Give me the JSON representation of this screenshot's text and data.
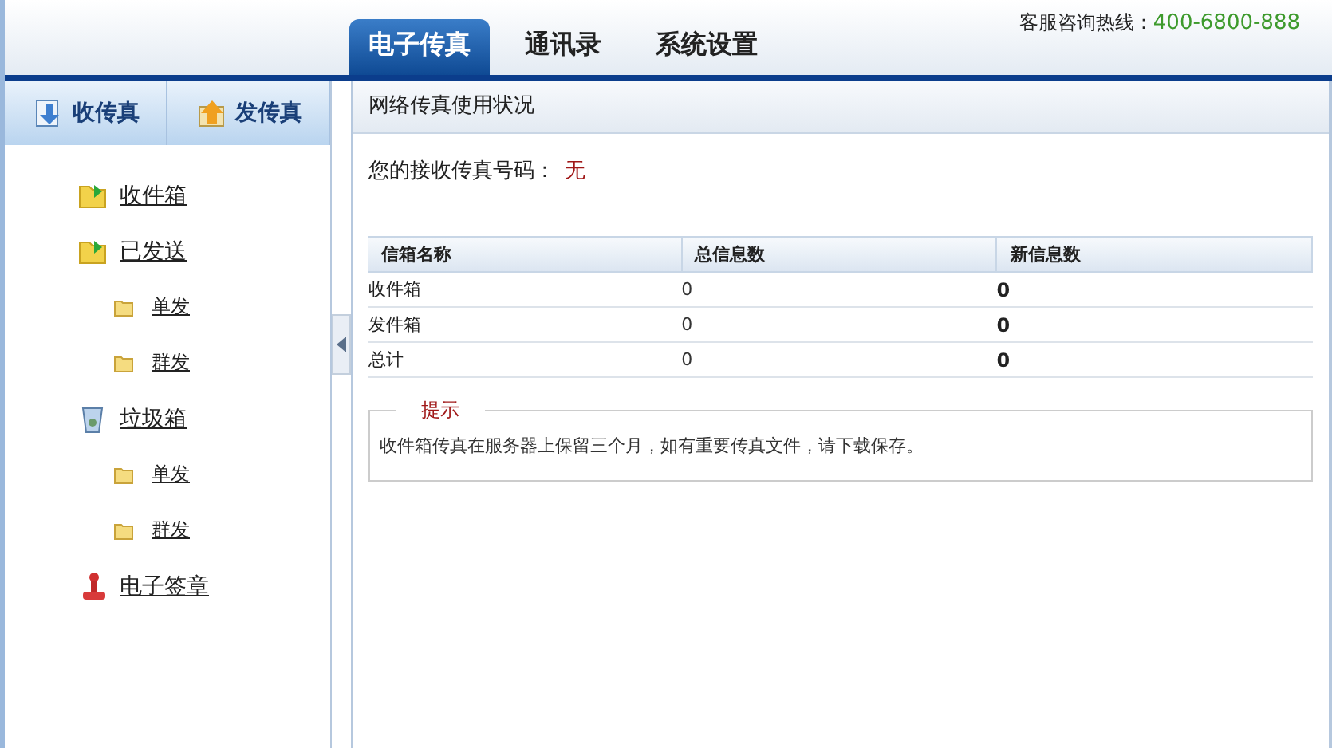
{
  "header": {
    "tabs": [
      {
        "label": "电子传真",
        "selected": true
      },
      {
        "label": "通讯录",
        "selected": false
      },
      {
        "label": "系统设置",
        "selected": false
      }
    ],
    "hotline_label": "客服咨询热线：",
    "hotline_number": "400-6800-888"
  },
  "sidebar": {
    "buttons": [
      {
        "label": "收传真",
        "kind": "receive"
      },
      {
        "label": "发传真",
        "kind": "send"
      }
    ],
    "items": [
      {
        "label": "收件箱",
        "kind": "inbox"
      },
      {
        "label": "已发送",
        "kind": "sent",
        "children": [
          {
            "label": "单发",
            "kind": "subfolder"
          },
          {
            "label": "群发",
            "kind": "subfolder"
          }
        ]
      },
      {
        "label": "垃圾箱",
        "kind": "trash",
        "children": [
          {
            "label": "单发",
            "kind": "subfolder"
          },
          {
            "label": "群发",
            "kind": "subfolder"
          }
        ]
      },
      {
        "label": "电子签章",
        "kind": "stamp"
      }
    ]
  },
  "main": {
    "title": "网络传真使用状况",
    "fax_number_label": "您的接收传真号码：",
    "fax_number_value": "无",
    "table": {
      "columns": [
        "信箱名称",
        "总信息数",
        "新信息数"
      ],
      "rows": [
        [
          "收件箱",
          "0",
          "0"
        ],
        [
          "发件箱",
          "0",
          "0"
        ],
        [
          "总计",
          "0",
          "0"
        ]
      ]
    },
    "tip": {
      "title": "提示",
      "text": "收件箱传真在服务器上保留三个月，如有重要传真文件，请下载保存。"
    }
  }
}
